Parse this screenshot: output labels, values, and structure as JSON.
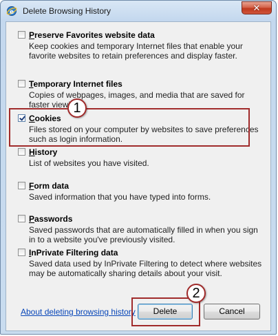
{
  "window": {
    "title": "Delete Browsing History",
    "close_glyph": "✕"
  },
  "options": [
    {
      "accel": "P",
      "title_rest": "reserve Favorites website data",
      "description": "Keep cookies and temporary Internet files that enable your favorite websites to retain preferences and display faster.",
      "checked": false
    },
    {
      "accel": "T",
      "title_rest": "emporary Internet files",
      "description": "Copies of webpages, images, and media that are saved for faster viewing.",
      "checked": false
    },
    {
      "accel": "C",
      "title_rest": "ookies",
      "description": "Files stored on your computer by websites to save preferences such as login information.",
      "checked": true
    },
    {
      "accel": "H",
      "title_rest": "istory",
      "description": "List of websites you have visited.",
      "checked": false
    },
    {
      "accel": "F",
      "title_rest": "orm data",
      "description": "Saved information that you have typed into forms.",
      "checked": false
    },
    {
      "accel": "P",
      "title_rest": "asswords",
      "description": "Saved passwords that are automatically filled in when you sign in to a website you've previously visited.",
      "checked": false
    },
    {
      "accel": "I",
      "title_rest": "nPrivate Filtering data",
      "description": "Saved data used by InPrivate Filtering to detect where websites may be automatically sharing details about your visit.",
      "checked": false
    }
  ],
  "footer": {
    "link_text": "About deleting browsing history",
    "delete_label": "Delete",
    "cancel_label": "Cancel"
  },
  "annotations": {
    "badge_1": "1",
    "badge_2": "2",
    "accent_color": "#a02a2a"
  }
}
